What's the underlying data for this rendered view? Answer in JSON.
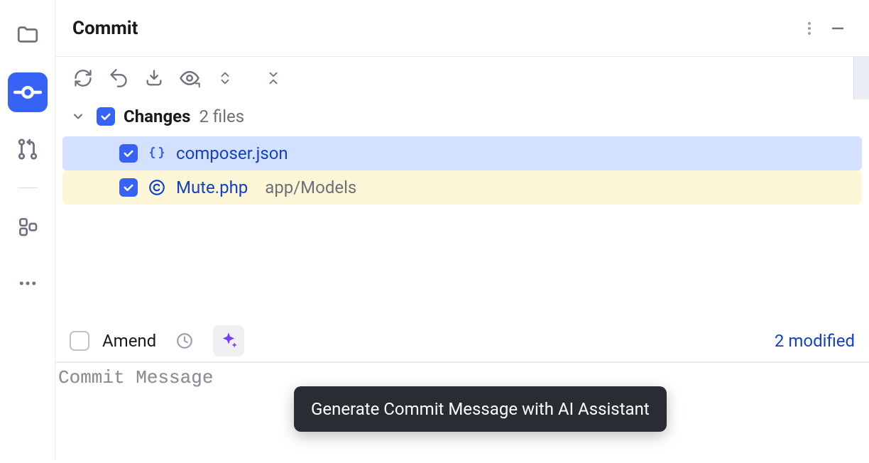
{
  "header": {
    "title": "Commit"
  },
  "changes": {
    "title": "Changes",
    "count_label": "2 files",
    "files": [
      {
        "name": "composer.json",
        "path": "",
        "icon": "braces",
        "checked": true,
        "selected": true
      },
      {
        "name": "Mute.php",
        "path": "app/Models",
        "icon": "circle-c",
        "checked": true,
        "selected": false
      }
    ]
  },
  "amend": {
    "label": "Amend",
    "checked": false
  },
  "status": {
    "modified_label": "2 modified"
  },
  "commit_message": {
    "placeholder": "Commit Message",
    "value": ""
  },
  "tooltip": {
    "text": "Generate Commit Message with AI Assistant"
  },
  "colors": {
    "accent": "#3662f5",
    "link": "#1440c8"
  }
}
